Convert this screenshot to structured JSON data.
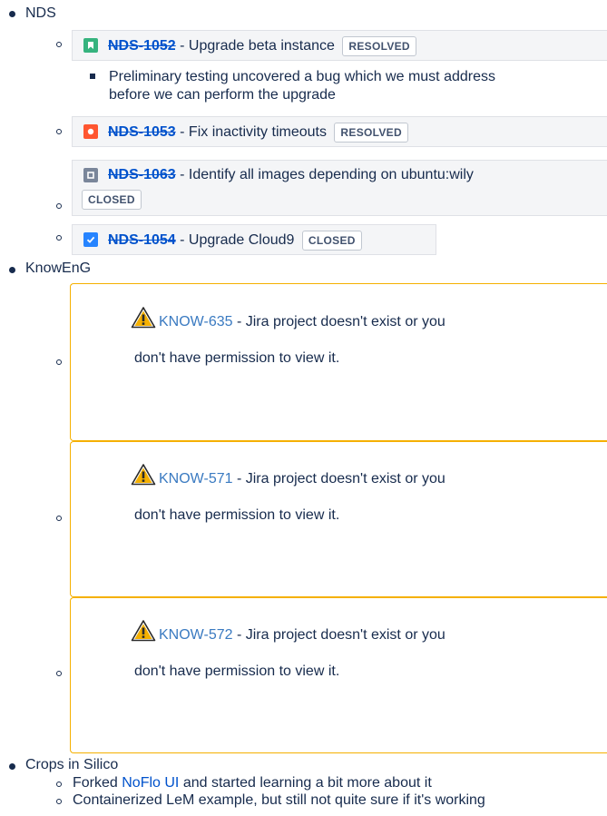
{
  "top_items": [
    {
      "label": "NDS"
    },
    {
      "label": "KnowEnG"
    },
    {
      "label": "Crops in Silico"
    }
  ],
  "colors": {
    "story_green": "#36b37e",
    "bug_red": "#ff5630",
    "task_blue": "#2684ff",
    "subtask_gray": "#7a869a",
    "warning_border": "#f5b000",
    "link_blue": "#0052cc"
  },
  "nds": {
    "issues": [
      {
        "icon": "story-icon",
        "key": "NDS-1052",
        "sep": " - ",
        "summary": "Upgrade beta instance",
        "status": "RESOLVED",
        "sub_note": "Preliminary testing uncovered a bug which we must address",
        "sub_note_line2": "before we can perform the upgrade"
      },
      {
        "icon": "bug-icon",
        "key": "NDS-1053",
        "sep": " - ",
        "summary": "Fix inactivity timeouts",
        "status": "RESOLVED"
      },
      {
        "icon": "subtask-icon",
        "key": "NDS-1063",
        "sep": " - ",
        "summary": "Identify all images depending on ubuntu:wily",
        "status": "CLOSED"
      },
      {
        "icon": "task-icon",
        "key": "NDS-1054",
        "sep": " - ",
        "summary": "Upgrade Cloud9",
        "status": "CLOSED"
      }
    ]
  },
  "knoweng": {
    "warnings": [
      {
        "key": "KNOW-635",
        "msg_line1": " - Jira project doesn't exist or you",
        "msg_line2": "don't have permission to view it."
      },
      {
        "key": "KNOW-571",
        "msg_line1": " - Jira project doesn't exist or you",
        "msg_line2": "don't have permission to view it."
      },
      {
        "key": "KNOW-572",
        "msg_line1": " - Jira project doesn't exist or you",
        "msg_line2": "don't have permission to view it."
      }
    ]
  },
  "crops": {
    "item1_pre": "Forked ",
    "item1_link": "NoFlo UI",
    "item1_post": " and started learning a bit more about it",
    "item2": "Containerized LeM example, but still not quite sure if it's working"
  }
}
